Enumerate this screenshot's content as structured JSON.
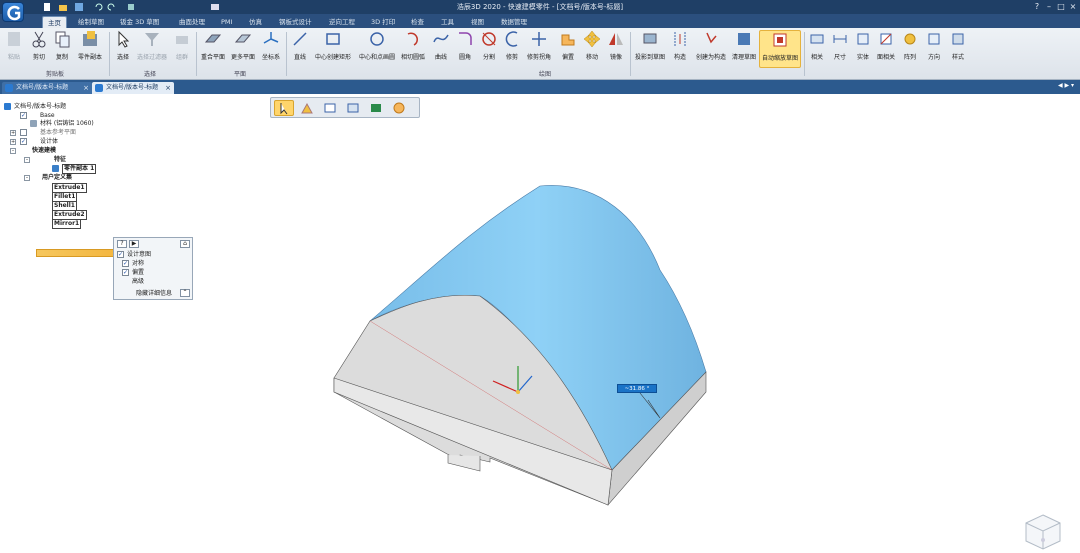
{
  "window": {
    "title": "浩辰3D 2020 - 快速建模零件 - [文档号/版本号-标题]",
    "controls": [
      "?",
      "–",
      "□",
      "×"
    ]
  },
  "tabs": [
    "主页",
    "绘制草图",
    "钣金 3D 草图",
    "曲面处理",
    "PMI",
    "仿真",
    "钢板式设计",
    "逆向工程",
    "3D 打印",
    "检查",
    "工具",
    "视图",
    "数据管理"
  ],
  "ribbon": {
    "tools": [
      {
        "label": "粘贴",
        "disabled": true
      },
      {
        "label": "剪切"
      },
      {
        "label": "复制"
      },
      {
        "label": "零件副本"
      },
      {
        "label": "选择"
      },
      {
        "label": "选择过滤器",
        "disabled": true
      },
      {
        "label": "组群",
        "disabled": true
      },
      {
        "label": "重合平面"
      },
      {
        "label": "更多平面"
      },
      {
        "label": "坐标系"
      },
      {
        "label": "直线"
      },
      {
        "label": "中心创建矩形"
      },
      {
        "label": "中心和点画圆"
      },
      {
        "label": "相切圆弧"
      },
      {
        "label": "曲线"
      },
      {
        "label": "圆角"
      },
      {
        "label": "分割"
      },
      {
        "label": "修剪"
      },
      {
        "label": "修剪拐角"
      },
      {
        "label": "偏置"
      },
      {
        "label": "移动"
      },
      {
        "label": "镜像"
      },
      {
        "label": "投影到草图"
      },
      {
        "label": "构造"
      },
      {
        "label": "创建为构造"
      },
      {
        "label": "清理草图"
      },
      {
        "label": "自动缩放草图",
        "active": true
      },
      {
        "label": "相关"
      },
      {
        "label": "尺寸"
      },
      {
        "label": "实体"
      },
      {
        "label": "面相关"
      },
      {
        "label": "阵列"
      },
      {
        "label": "方向"
      },
      {
        "label": "样式"
      }
    ],
    "groups": [
      "剪贴板",
      "选择",
      "平面",
      "绘图"
    ]
  },
  "doc_tabs": [
    "文档号/版本号-标题",
    "文档号/版本号-标题"
  ],
  "tree": {
    "root": "文档号/版本号-标题",
    "base": "Base",
    "material": "材料 (铝铸铝 1060)",
    "ref_planes": "基本参考平面",
    "design_body": "设计体",
    "quick_build": "快速建模",
    "features": "特征",
    "part_copy": "零件副本 1",
    "user_set": "用户定义集",
    "items": [
      "Extrude1",
      "Fillet1",
      "Shell1",
      "Extrude2",
      "Mirror1"
    ]
  },
  "panel": {
    "buttons": [
      "?",
      "▶",
      "⌂"
    ],
    "rows": [
      "设计意图",
      "对称",
      "偏置",
      "高级"
    ],
    "footer": "隐藏详细信息"
  },
  "dimension": {
    "value": "~31.86 °"
  },
  "colors": {
    "titlebar": "#1f3f66",
    "ribbon": "#e6ebf1",
    "model_top": "#7fc5ef",
    "model_side": "#ddd",
    "highlight": "#ffd56b"
  }
}
